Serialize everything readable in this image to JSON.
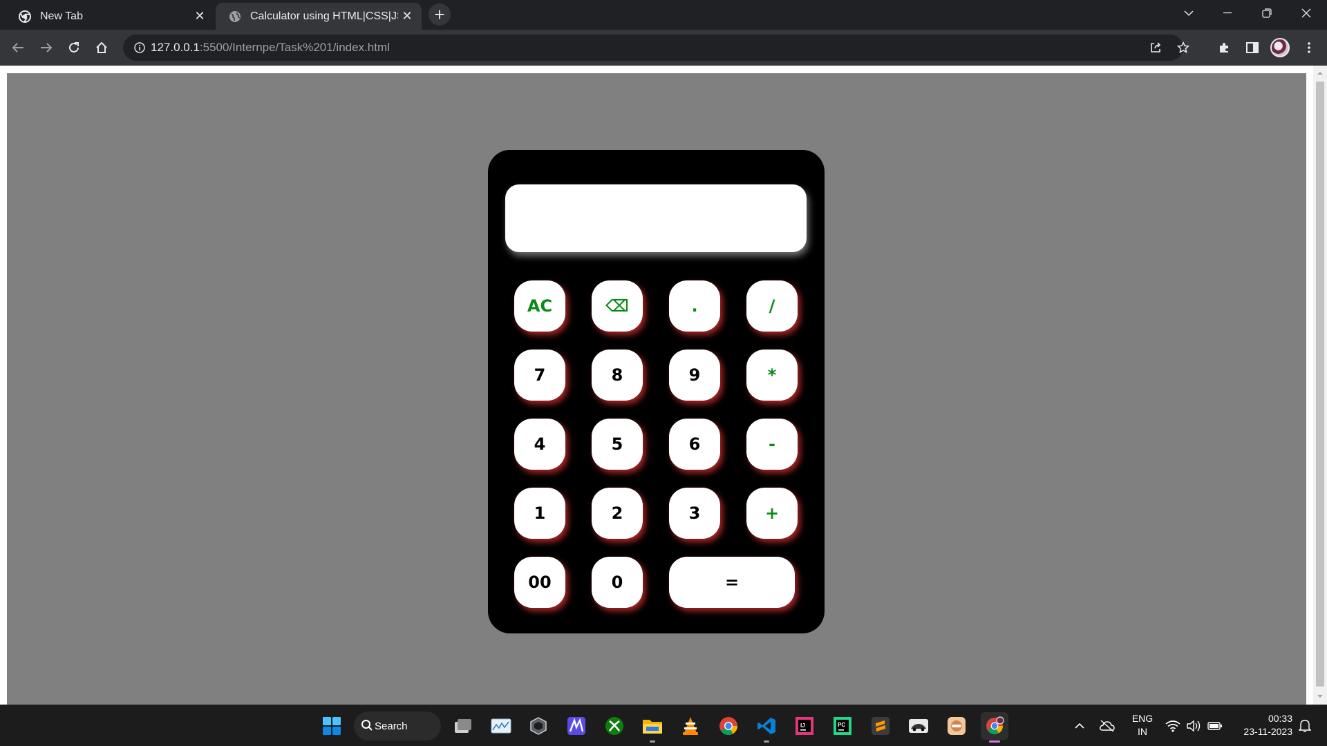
{
  "browser": {
    "tabs": [
      {
        "title": "New Tab",
        "icon": "chrome-icon",
        "active": false
      },
      {
        "title": "Calculator using HTML|CSS|JS",
        "icon": "globe-icon",
        "active": true
      }
    ],
    "new_tab_glyph": "+",
    "close_glyph": "✕",
    "address": {
      "host": "127.0.0.1",
      "path": ":5500/Internpe/Task%201/index.html"
    }
  },
  "calculator": {
    "display_value": "",
    "keys": [
      {
        "label": "AC",
        "type": "op"
      },
      {
        "label": "⌫",
        "type": "op"
      },
      {
        "label": ".",
        "type": "op"
      },
      {
        "label": "/",
        "type": "op"
      },
      {
        "label": "7",
        "type": "num"
      },
      {
        "label": "8",
        "type": "num"
      },
      {
        "label": "9",
        "type": "num"
      },
      {
        "label": "*",
        "type": "op"
      },
      {
        "label": "4",
        "type": "num"
      },
      {
        "label": "5",
        "type": "num"
      },
      {
        "label": "6",
        "type": "num"
      },
      {
        "label": "-",
        "type": "op"
      },
      {
        "label": "1",
        "type": "num"
      },
      {
        "label": "2",
        "type": "num"
      },
      {
        "label": "3",
        "type": "num"
      },
      {
        "label": "+",
        "type": "op"
      },
      {
        "label": "00",
        "type": "num"
      },
      {
        "label": "0",
        "type": "num"
      },
      {
        "label": "=",
        "type": "num"
      }
    ],
    "colors": {
      "operator_text": "#0b8a16",
      "key_shadow": "#dc3232",
      "body": "#000000",
      "page_background": "#808080"
    }
  },
  "taskbar": {
    "search_label": "Search",
    "apps": [
      "start-icon",
      "task-view-icon",
      "photos-icon",
      "3d-viewer-icon",
      "mathpix-icon",
      "xbox-icon",
      "file-explorer-icon",
      "vlc-icon",
      "chrome-icon",
      "vscode-icon",
      "intellij-icon",
      "pycharm-icon",
      "sublime-icon",
      "racing-game-icon",
      "emulator-icon",
      "chrome-profile-icon"
    ],
    "language": {
      "line1": "ENG",
      "line2": "IN"
    },
    "clock": {
      "time": "00:33",
      "date": "23-11-2023"
    }
  }
}
